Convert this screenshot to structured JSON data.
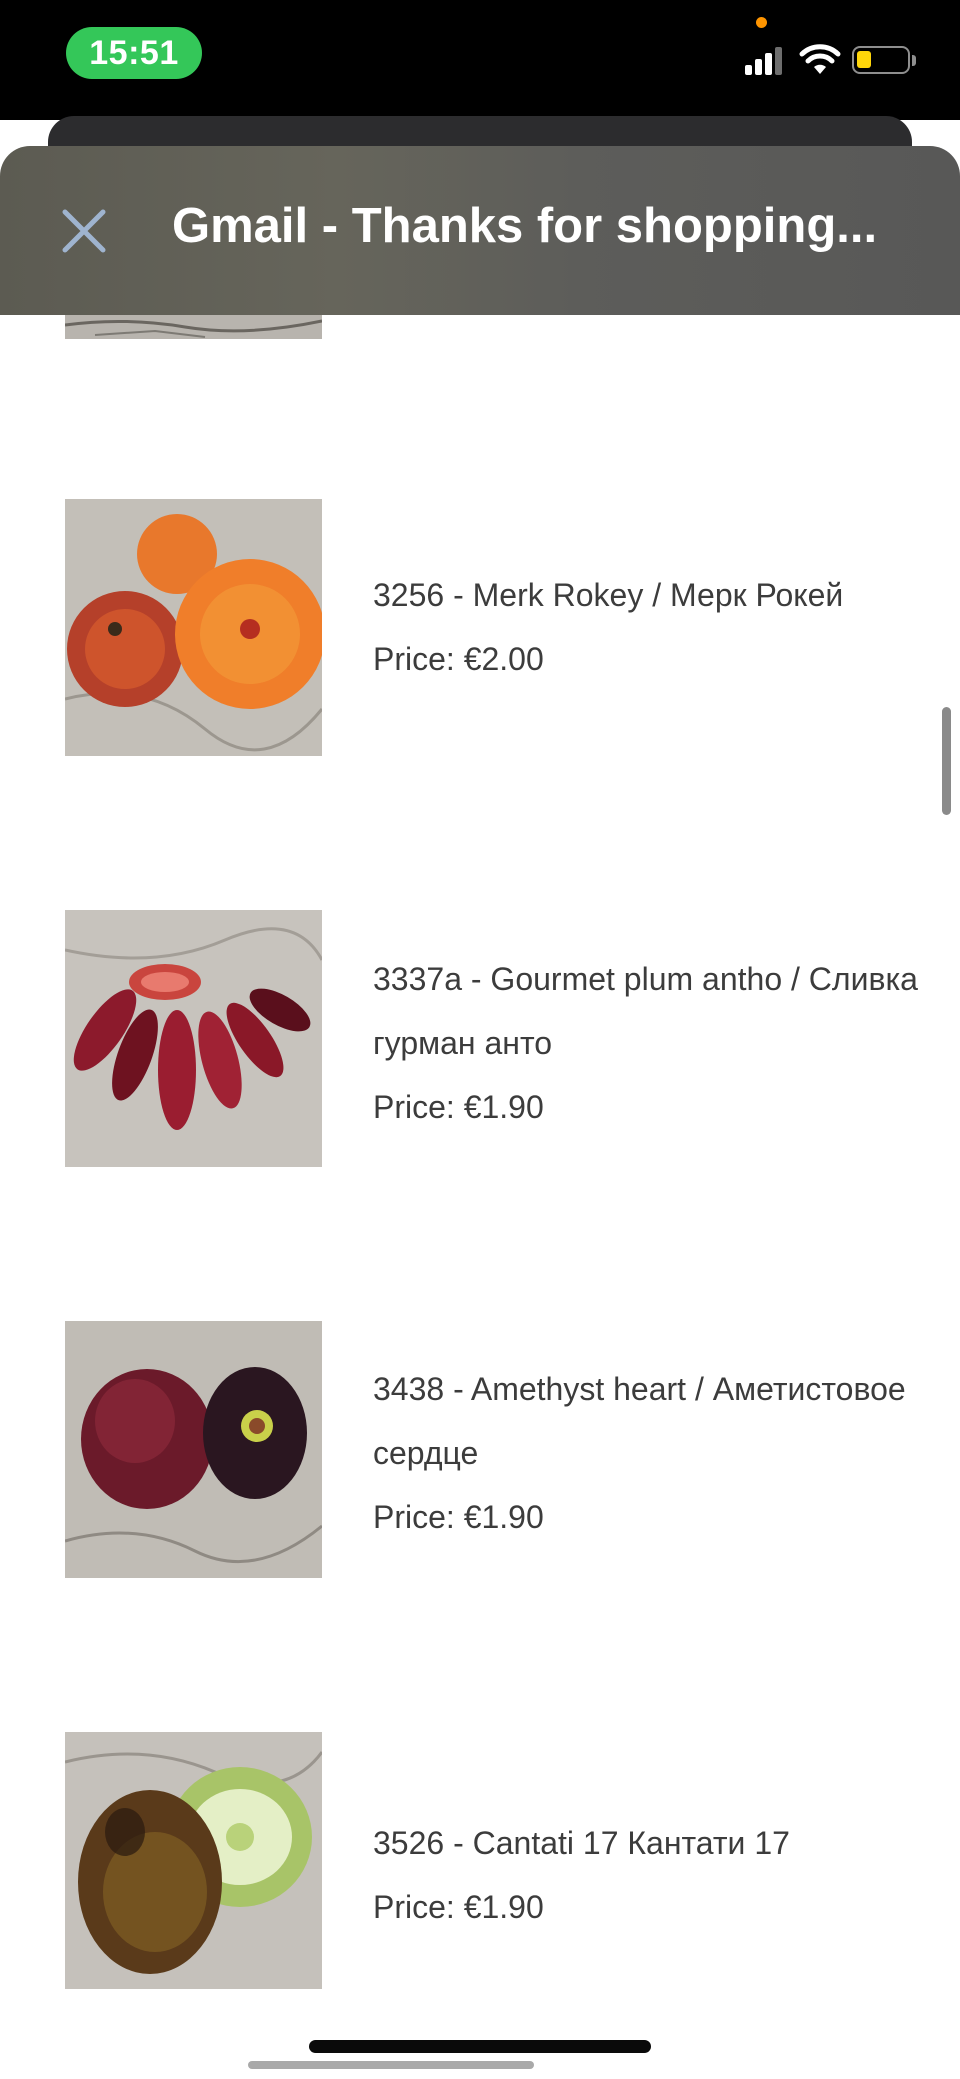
{
  "status_bar": {
    "time": "15:51"
  },
  "header": {
    "title": "Gmail - Thanks for shopping..."
  },
  "items": [
    {
      "name": "3256 - Merk Rokey / Мерк Рокей",
      "price": "Price: €2.00"
    },
    {
      "name": "3337a - Gourmet plum antho / Сливка гурман анто",
      "price": "Price: €1.90"
    },
    {
      "name": "3438 - Amethyst heart / Аметистовое сердце",
      "price": "Price: €1.90"
    },
    {
      "name": "3526 - Cantati 17 Кантати 17",
      "price": "Price: €1.90"
    }
  ],
  "icons": {
    "close": "close-icon",
    "signal": "cellular-signal-icon",
    "wifi": "wifi-icon",
    "battery": "battery-icon"
  },
  "colors": {
    "time_pill": "#34c759",
    "header_bg": "#5f5e56",
    "battery_fill": "#ffd60a",
    "text": "#3c3c3c"
  }
}
